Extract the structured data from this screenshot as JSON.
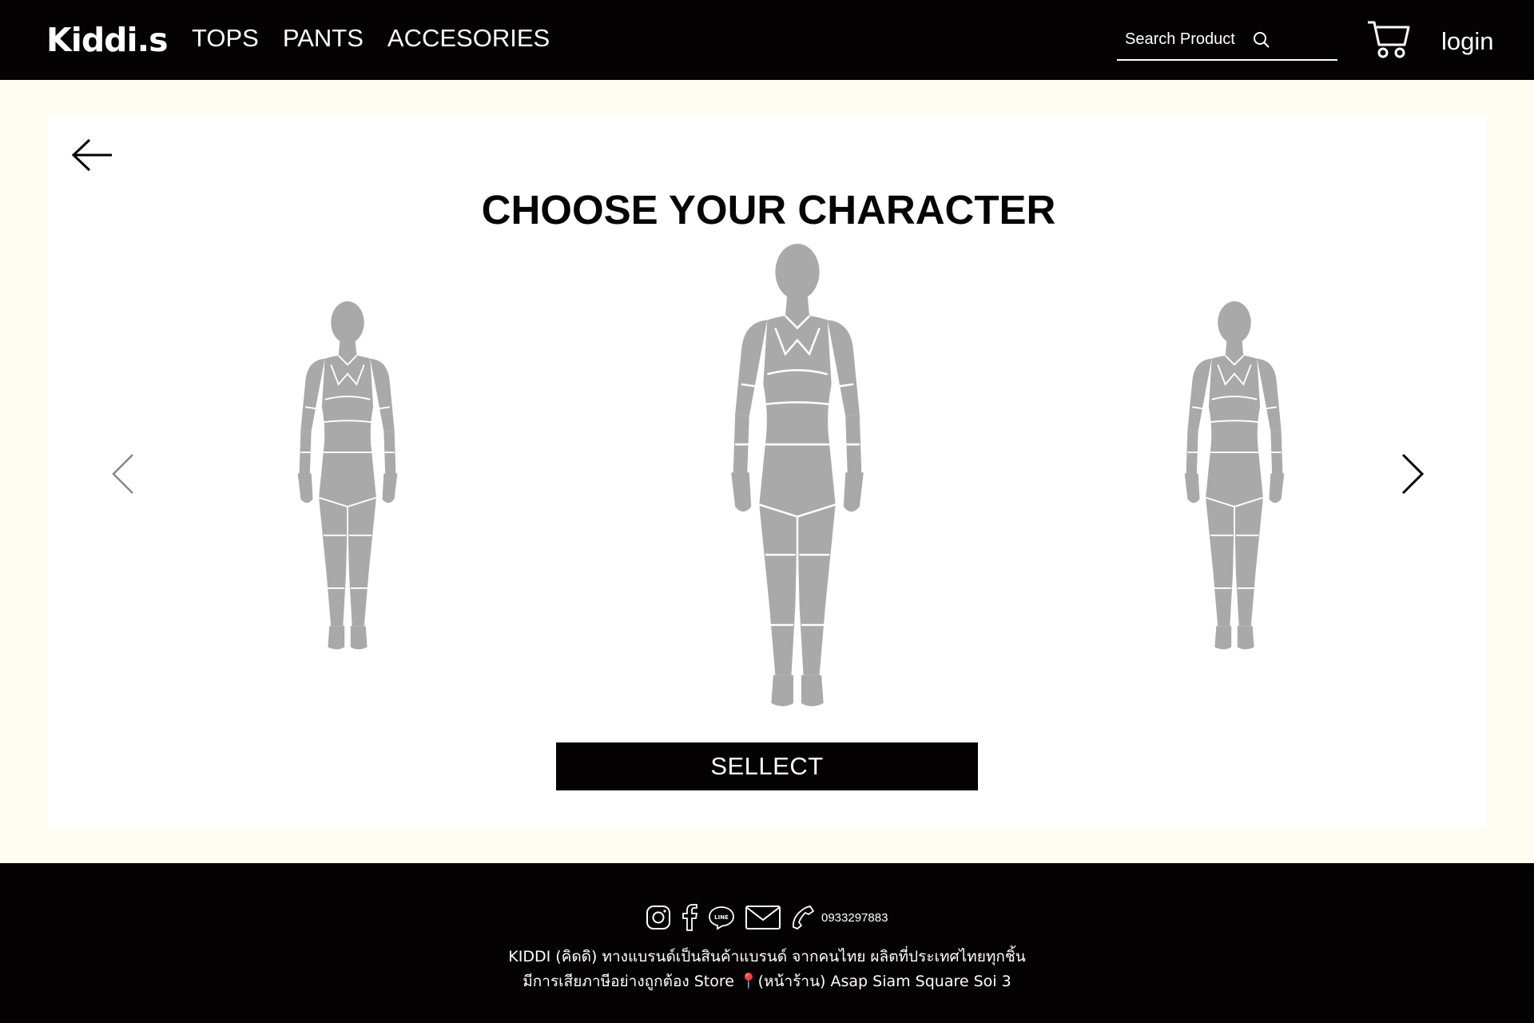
{
  "header": {
    "logo": "Kiddi.s",
    "nav": [
      {
        "label": "TOPS"
      },
      {
        "label": "PANTS"
      },
      {
        "label": "ACCESORIES"
      }
    ],
    "search_placeholder": "Search Product",
    "login_label": "login"
  },
  "main": {
    "title": "CHOOSE YOUR CHARACTER",
    "select_label": "SELLECT",
    "figure_color": "#a9a9a9"
  },
  "footer": {
    "phone": "0933297883",
    "line1": "KIDDI (คิดดิ) ทางแบรนด์เป็นสินค้าแบรนด์ จากคนไทย ผลิตที่ประเทศไทยทุกชิ้น",
    "line2": "มีการเสียภาษีอย่างถูกต้อง Store 📍(หน้าร้าน) Asap Siam Square Soi 3"
  },
  "colors": {
    "header_bg": "#040203",
    "page_bg": "#fffcf2",
    "card_bg": "#ffffff",
    "figure": "#a9a9a9"
  }
}
